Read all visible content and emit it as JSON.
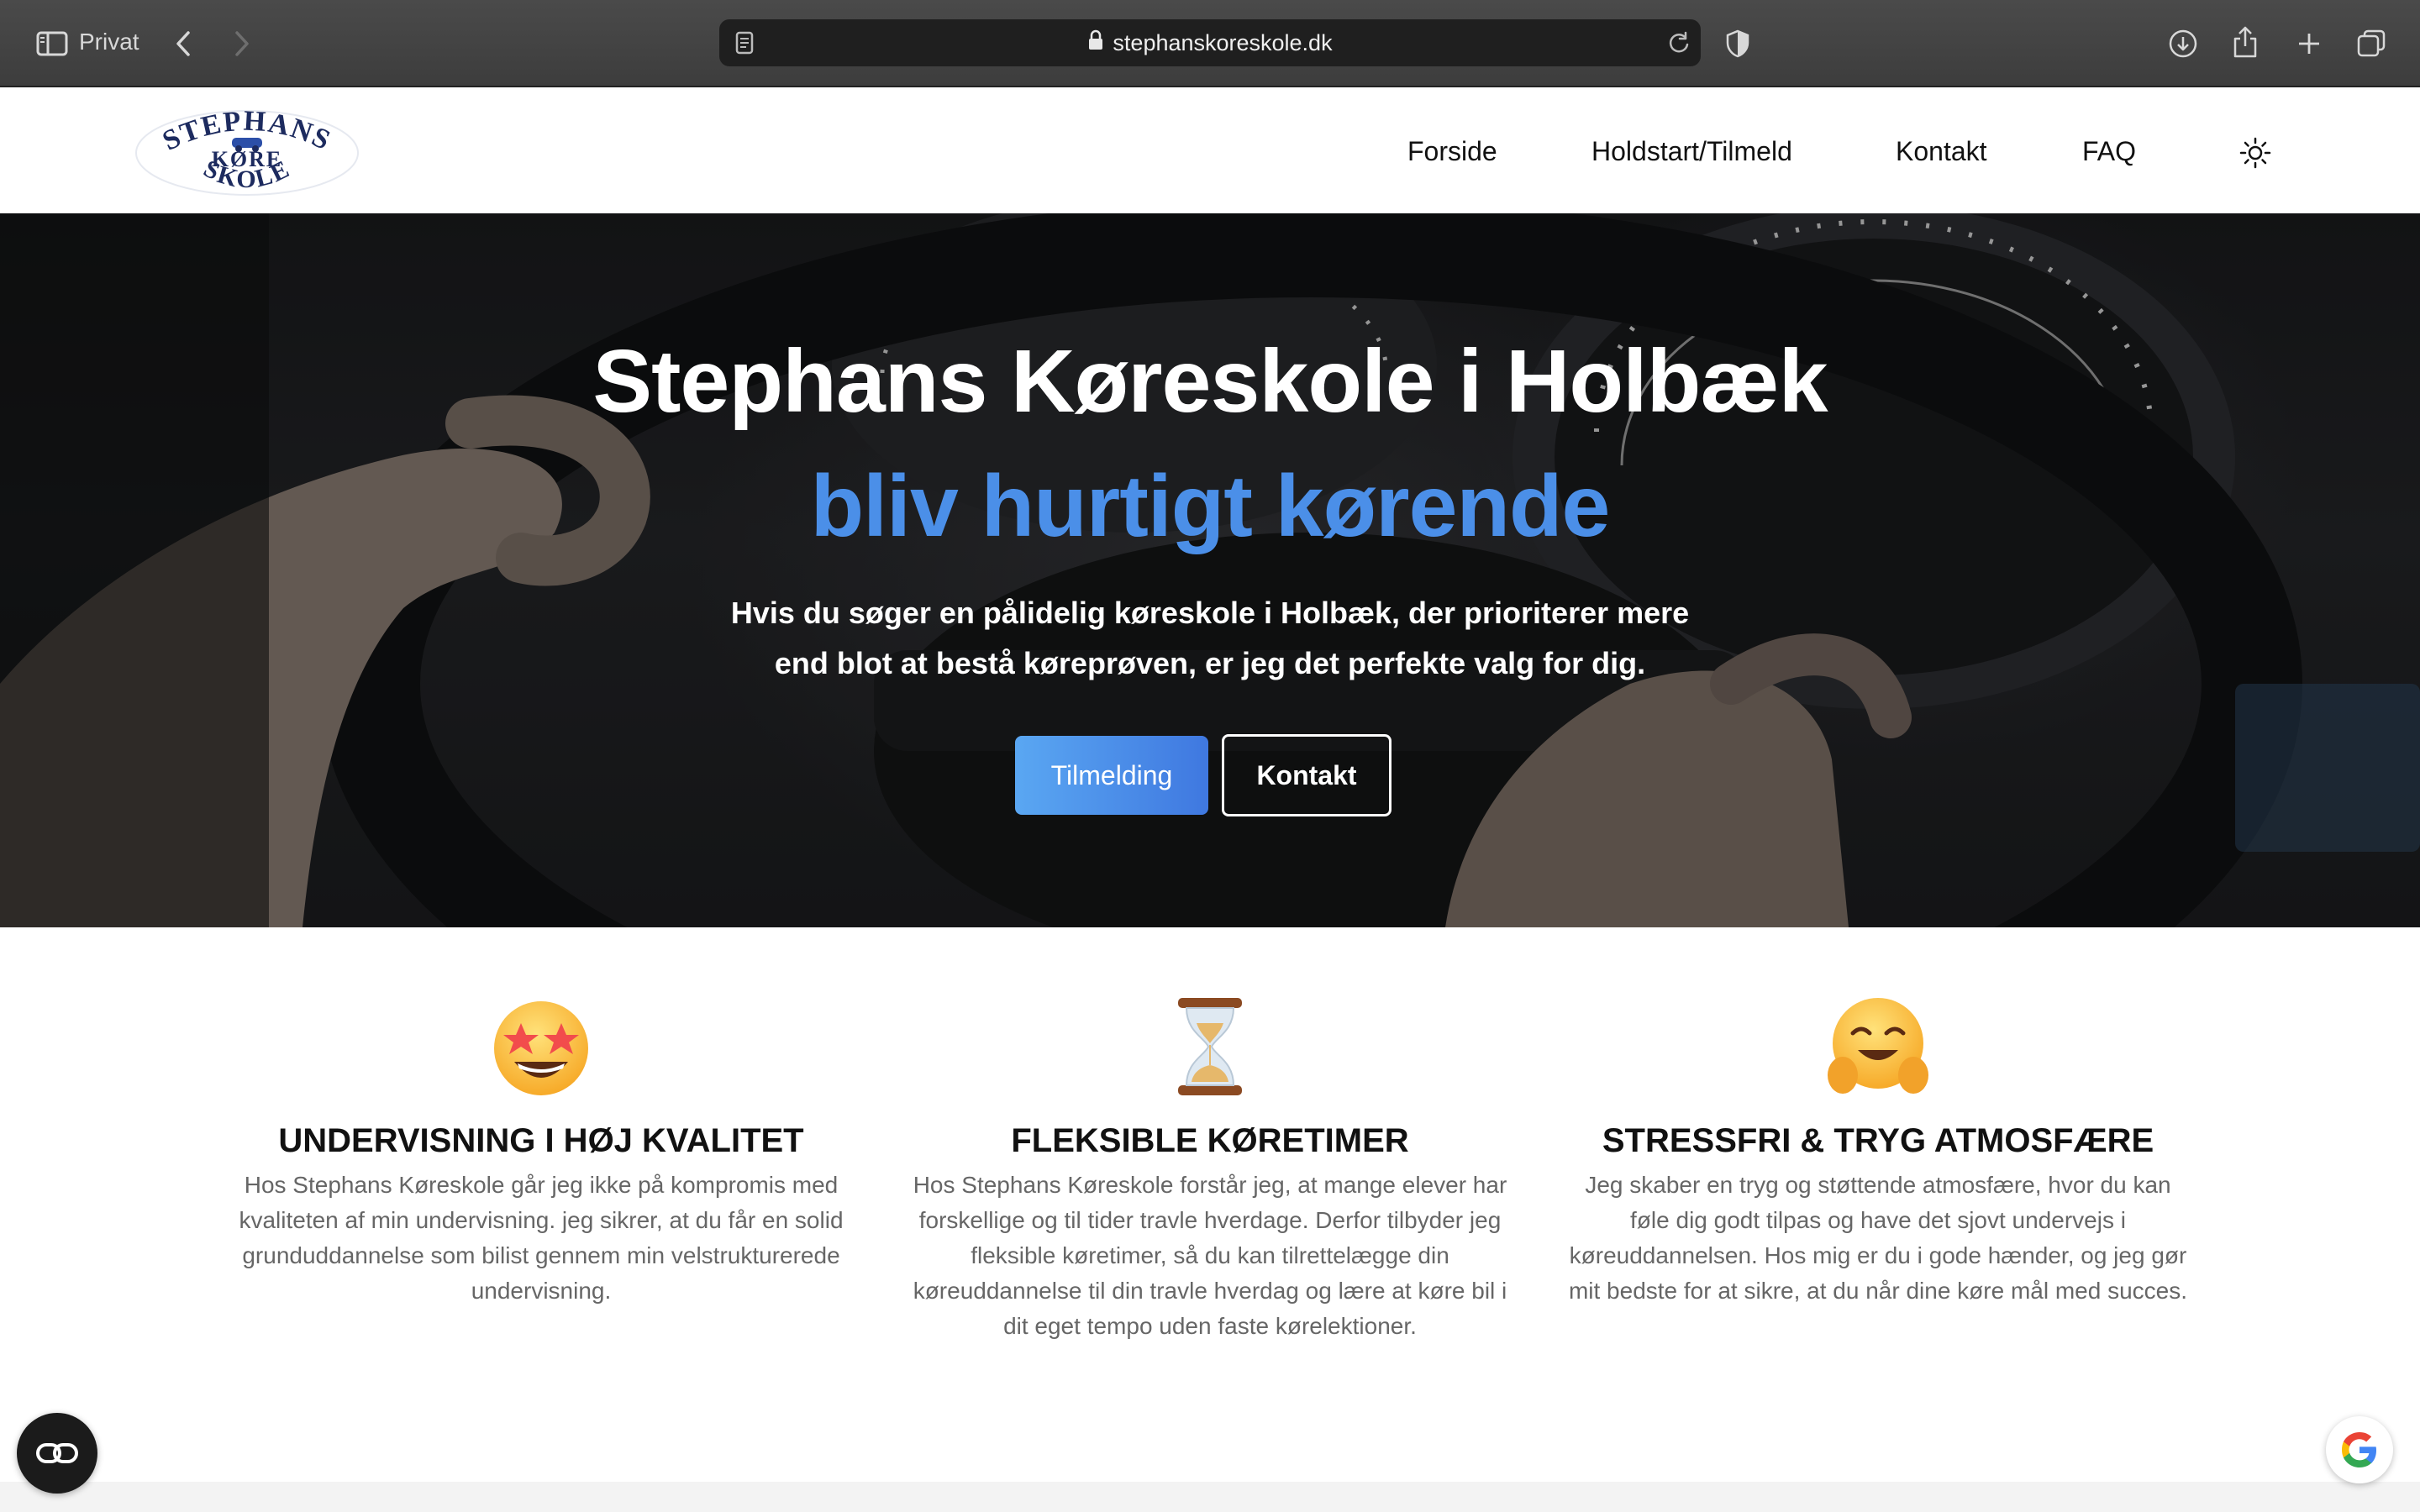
{
  "browser": {
    "private_label": "Privat",
    "url": "stephanskoreskole.dk"
  },
  "header": {
    "logo_text": "STEPHANS KØRE SKOLE",
    "nav": [
      {
        "label": "Forside"
      },
      {
        "label": "Holdstart/Tilmeld"
      },
      {
        "label": "Kontakt"
      },
      {
        "label": "FAQ"
      }
    ]
  },
  "hero": {
    "title": "Stephans Køreskole i Holbæk",
    "subtitle": "bliv hurtigt kørende",
    "description": "Hvis du søger en pålidelig køreskole i Holbæk, der prioriterer mere end blot at bestå køreprøven, er jeg det perfekte valg for dig.",
    "primary_button": "Tilmelding",
    "secondary_button": "Kontakt"
  },
  "features": [
    {
      "icon": "star-struck-emoji",
      "title": "UNDERVISNING I HØJ KVALITET",
      "text": "Hos Stephans Køreskole går jeg ikke på kompromis med kvaliteten af min undervisning. jeg sikrer, at du får en solid grunduddannelse som bilist gennem min velstrukturerede undervisning."
    },
    {
      "icon": "hourglass-emoji",
      "title": "FLEKSIBLE KØRETIMER",
      "text": "Hos Stephans Køreskole forstår jeg, at mange elever har forskellige og til tider travle hverdage. Derfor tilbyder jeg fleksible køretimer, så du kan tilrettelægge din køreuddannelse til din travle hverdag og lære at køre bil i dit eget tempo uden faste kørelektioner."
    },
    {
      "icon": "hugging-face-emoji",
      "title": "STRESSFRI & TRYG ATMOSFÆRE",
      "text": "Jeg skaber en tryg og støttende atmosfære, hvor du kan føle dig godt tilpas og have det sjovt undervejs i køreuddannelsen. Hos mig er du i gode hænder, og jeg gør mit bedste for at sikre, at du når dine køre mål med succes."
    }
  ],
  "colors": {
    "accent_blue": "#4b8fe8",
    "button_gradient_start": "#5aa7f2",
    "button_gradient_end": "#3f78e0"
  }
}
